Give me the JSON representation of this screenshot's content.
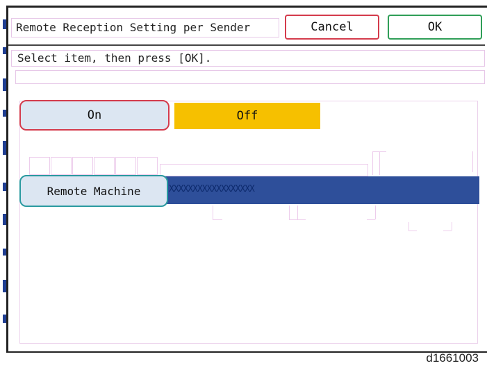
{
  "header": {
    "title": "Remote Reception Setting per Sender",
    "cancel_label": "Cancel",
    "ok_label": "OK"
  },
  "message": "Select item, then press [OK].",
  "toggle": {
    "on_label": "On",
    "off_label": "Off",
    "selected": "Off"
  },
  "remote_machine": {
    "button_label": "Remote Machine",
    "value": "XXXXXXXXXXXXXXXXXX"
  },
  "figure_id": "d1661003",
  "colors": {
    "selected_toggle": "#f6c000",
    "field_bar": "#2e4f9a",
    "cancel_border": "#d43b4c",
    "ok_border": "#2f9e57",
    "button_fill": "#dce6f2"
  }
}
